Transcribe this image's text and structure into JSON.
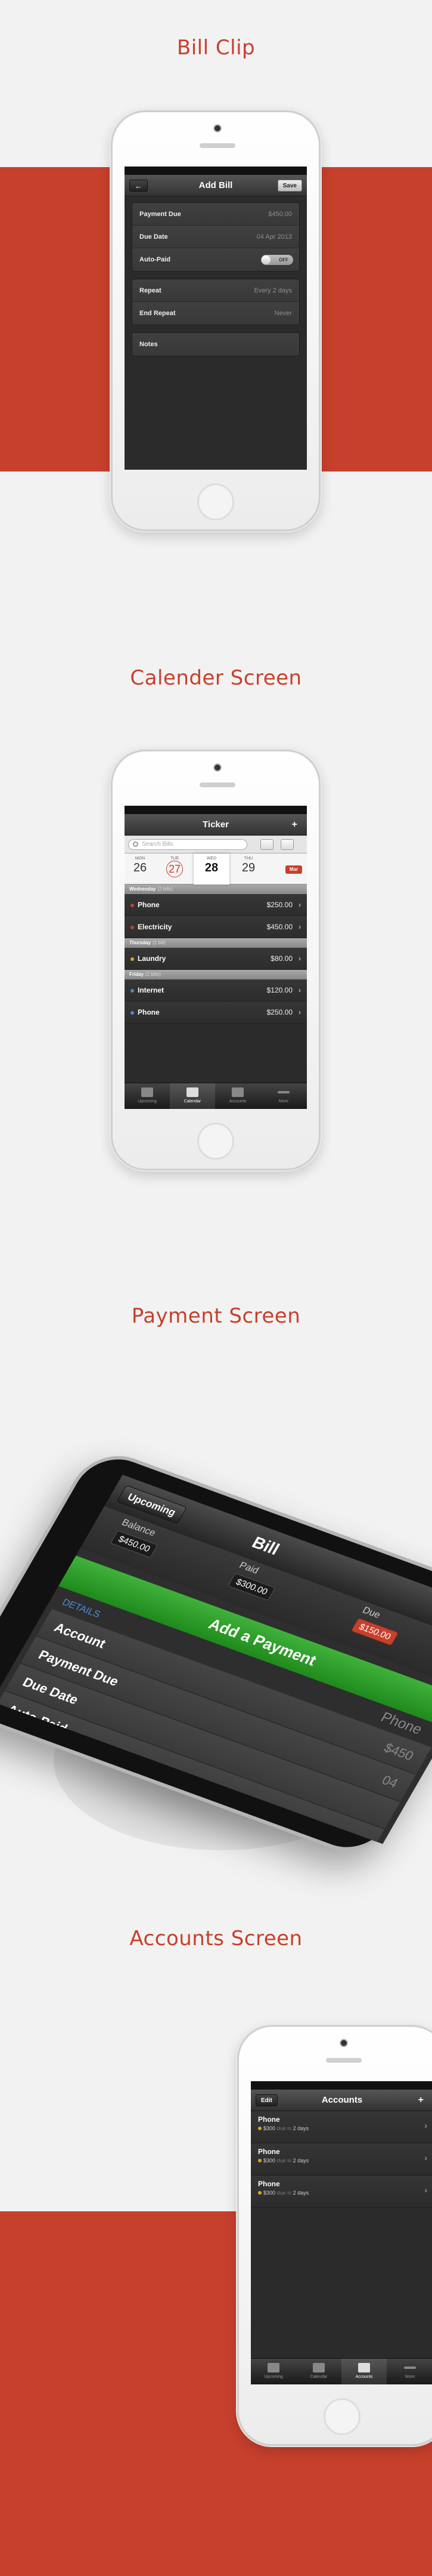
{
  "sections": {
    "bill_clip": "Bill Clip",
    "calender": "Calender Screen",
    "payment": "Payment Screen",
    "accounts": "Accounts Screen"
  },
  "add_bill": {
    "back_icon": "arrow-left-icon",
    "title": "Add Bill",
    "save": "Save",
    "group1": [
      {
        "label": "Payment Due",
        "value": "$450.00"
      },
      {
        "label": "Due Date",
        "value": "04 Apr 2013"
      },
      {
        "label": "Auto-Paid",
        "value": "OFF"
      }
    ],
    "group2": [
      {
        "label": "Repeat",
        "value": "Every 2 days"
      },
      {
        "label": "End Repeat",
        "value": "Never"
      }
    ],
    "notes": "Notes"
  },
  "ticker": {
    "title": "Ticker",
    "plus": "+",
    "search_placeholder": "Search Bills",
    "days": [
      {
        "name": "MON",
        "num": "26"
      },
      {
        "name": "TUE",
        "num": "27"
      },
      {
        "name": "WED",
        "num": "28"
      },
      {
        "name": "THU",
        "num": "29"
      }
    ],
    "month_btn": "Mar",
    "groups": [
      {
        "head": "Wednesday",
        "count": "(2 bills)",
        "bills": [
          {
            "name": "Phone",
            "amount": "$250.00",
            "color": "#c7402c"
          },
          {
            "name": "Electricity",
            "amount": "$450.00",
            "color": "#c7402c"
          }
        ]
      },
      {
        "head": "Thursday",
        "count": "(1 bill)",
        "bills": [
          {
            "name": "Laundry",
            "amount": "$80.00",
            "color": "#e0a11b"
          }
        ]
      },
      {
        "head": "Friday",
        "count": "(2 bills)",
        "bills": [
          {
            "name": "Internet",
            "amount": "$120.00",
            "color": "#4a8bd6"
          },
          {
            "name": "Phone",
            "amount": "$250.00",
            "color": "#4a8bd6"
          }
        ]
      }
    ],
    "tabs": [
      "Upcoming",
      "Calendar",
      "Accounts",
      "More"
    ]
  },
  "payment": {
    "back": "Upcoming",
    "title": "Bill",
    "balance_label": "Balance",
    "balance": "$450.00",
    "paid_label": "Paid",
    "paid": "$300.00",
    "due_label": "Due",
    "due": "$150.00",
    "add": "Add a Payment",
    "details": "DETAILS",
    "phone": "Phone",
    "rows": [
      {
        "label": "Account",
        "value": "$450"
      },
      {
        "label": "Payment Due",
        "value": "04"
      },
      {
        "label": "Due Date",
        "value": ""
      },
      {
        "label": "Auto-Paid",
        "value": ""
      }
    ]
  },
  "accounts": {
    "edit": "Edit",
    "title": "Accounts",
    "plus": "+",
    "items": [
      {
        "name": "Phone",
        "amount": "$300",
        "due_word": "due in",
        "when": "2 days"
      },
      {
        "name": "Phone",
        "amount": "$300",
        "due_word": "due in",
        "when": "2 days"
      },
      {
        "name": "Phone",
        "amount": "$300",
        "due_word": "due in",
        "when": "2 days"
      }
    ],
    "tabs": [
      "Upcoming",
      "Calendar",
      "Accounts",
      "More"
    ]
  }
}
